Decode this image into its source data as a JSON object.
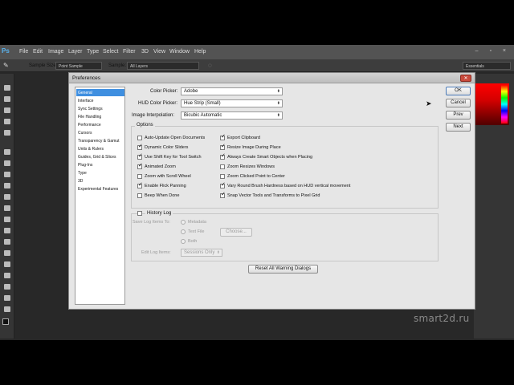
{
  "app": {
    "logo": "Ps",
    "menu": [
      "File",
      "Edit",
      "Image",
      "Layer",
      "Type",
      "Select",
      "Filter",
      "3D",
      "View",
      "Window",
      "Help"
    ],
    "options_bar": {
      "sample_size_label": "Sample Size:",
      "sample_size_value": "Point Sample",
      "sample_label": "Sample:",
      "sample_value": "All Layers",
      "workspace": "Essentials"
    }
  },
  "dialog": {
    "title": "Preferences",
    "categories": [
      "General",
      "Interface",
      "Sync Settings",
      "File Handling",
      "Performance",
      "Cursors",
      "Transparency & Gamut",
      "Units & Rulers",
      "Guides, Grid & Slices",
      "Plug-Ins",
      "Type",
      "3D",
      "Experimental Features"
    ],
    "selected_category": "General",
    "color_picker_label": "Color Picker:",
    "color_picker_value": "Adobe",
    "hud_label": "HUD Color Picker:",
    "hud_value": "Hue Strip (Small)",
    "interp_label": "Image Interpolation:",
    "interp_value": "Bicubic Automatic",
    "options_title": "Options",
    "options_left": [
      {
        "label": "Auto-Update Open Documents",
        "checked": false
      },
      {
        "label": "Dynamic Color Sliders",
        "checked": true
      },
      {
        "label": "Use Shift Key for Tool Switch",
        "checked": true
      },
      {
        "label": "Animated Zoom",
        "checked": true
      },
      {
        "label": "Zoom with Scroll Wheel",
        "checked": false
      },
      {
        "label": "Enable Flick Panning",
        "checked": true
      },
      {
        "label": "Beep When Done",
        "checked": false
      }
    ],
    "options_right": [
      {
        "label": "Export Clipboard",
        "checked": true
      },
      {
        "label": "Resize Image During Place",
        "checked": true
      },
      {
        "label": "Always Create Smart Objects when Placing",
        "checked": true
      },
      {
        "label": "Zoom Resizes Windows",
        "checked": false
      },
      {
        "label": "Zoom Clicked Point to Center",
        "checked": false
      },
      {
        "label": "Vary Round Brush Hardness based on HUD vertical movement",
        "checked": true
      },
      {
        "label": "Snap Vector Tools and Transforms to Pixel Grid",
        "checked": true
      }
    ],
    "history_log_label": "History Log",
    "save_log_label": "Save Log Items To:",
    "metadata_label": "Metadata",
    "textfile_label": "Text File",
    "choose_label": "Choose...",
    "both_label": "Both",
    "edit_log_label": "Edit Log Items:",
    "edit_log_value": "Sessions Only",
    "reset_warnings_label": "Reset All Warning Dialogs",
    "buttons": {
      "ok": "OK",
      "cancel": "Cancel",
      "prev": "Prev",
      "next": "Next"
    }
  },
  "watermark": "smart2d.ru"
}
